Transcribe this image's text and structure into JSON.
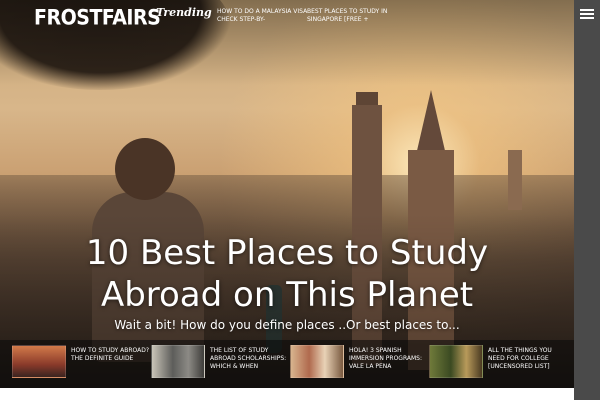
{
  "header": {
    "logo": "FROSTFAIRS",
    "trending_label": "Trending",
    "trending_items": [
      "HOW TO DO A MALAYSIA VISA CHECK STEP-BY-",
      "BEST PLACES TO STUDY IN SINGAPORE [FREE +"
    ]
  },
  "hero": {
    "headline_line1": "10 Best Places to Study",
    "headline_line2": "Abroad on This Planet",
    "subtitle": "Wait a bit! How do you define places ..Or best places to..."
  },
  "featured": [
    {
      "title": "HOW TO STUDY ABROAD? THE DEFINITE GUIDE",
      "thumb_color": "#b8553a"
    },
    {
      "title": "THE LIST OF STUDY ABROAD SCHOLARSHIPS: WHICH & WHEN",
      "thumb_color": "#8a8f8e"
    },
    {
      "title": "HOLA! 3 SPANISH IMMERSION PROGRAMS: VALE LA PENA",
      "thumb_color": "#9a7a5e"
    },
    {
      "title": "ALL THE THINGS YOU NEED FOR COLLEGE [UNCENSORED LIST]",
      "thumb_color": "#5c6a3a"
    }
  ],
  "icons": {
    "menu": "hamburger-icon"
  }
}
